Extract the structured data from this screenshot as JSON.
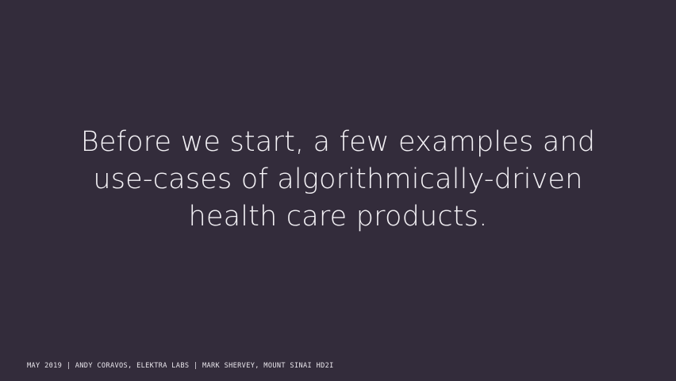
{
  "slide": {
    "headline_lines": [
      "Before we start, a few examples and",
      "use-cases of algorithmically-driven",
      "health care products."
    ],
    "footer": "MAY 2019 | ANDY CORAVOS, ELEKTRA LABS | MARK SHERVEY, MOUNT SINAI HD2I",
    "background_color": "#332c3b",
    "text_color": "#f4f2f6"
  }
}
